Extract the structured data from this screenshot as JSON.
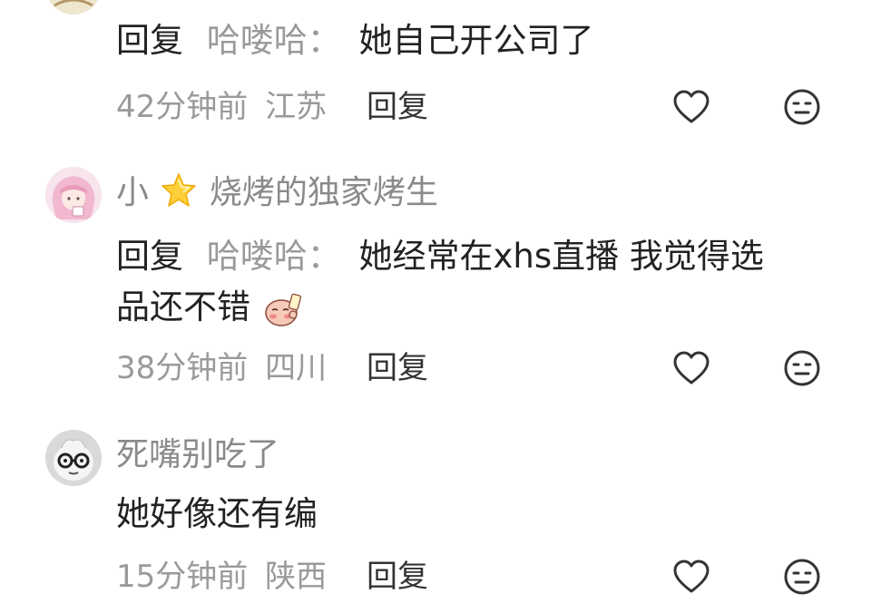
{
  "comments": [
    {
      "reply_label": "回复",
      "reply_target": "哈喽哈：",
      "text": "她自己开公司了",
      "time": "42分钟前",
      "location": "江苏",
      "reply_button": "回复"
    },
    {
      "user": "小",
      "user_suffix": "烧烤的独家烤生",
      "reply_label": "回复",
      "reply_target": "哈喽哈：",
      "text_line1": "她经常在xhs直播 我觉得选",
      "text_line2": "品还不错",
      "time": "38分钟前",
      "location": "四川",
      "reply_button": "回复"
    },
    {
      "user": "死嘴别吃了",
      "text": "她好像还有编",
      "time": "15分钟前",
      "location": "陕西",
      "reply_button": "回复"
    }
  ],
  "icons": {
    "like": "heart-outline-icon",
    "dislike": "neutral-face-icon",
    "star": "star-emoji",
    "emoji": "blushing-emoji-sticker"
  },
  "colors": {
    "primary_text": "#222222",
    "secondary_text": "#9a9a9a",
    "icon_stroke": "#333333"
  }
}
